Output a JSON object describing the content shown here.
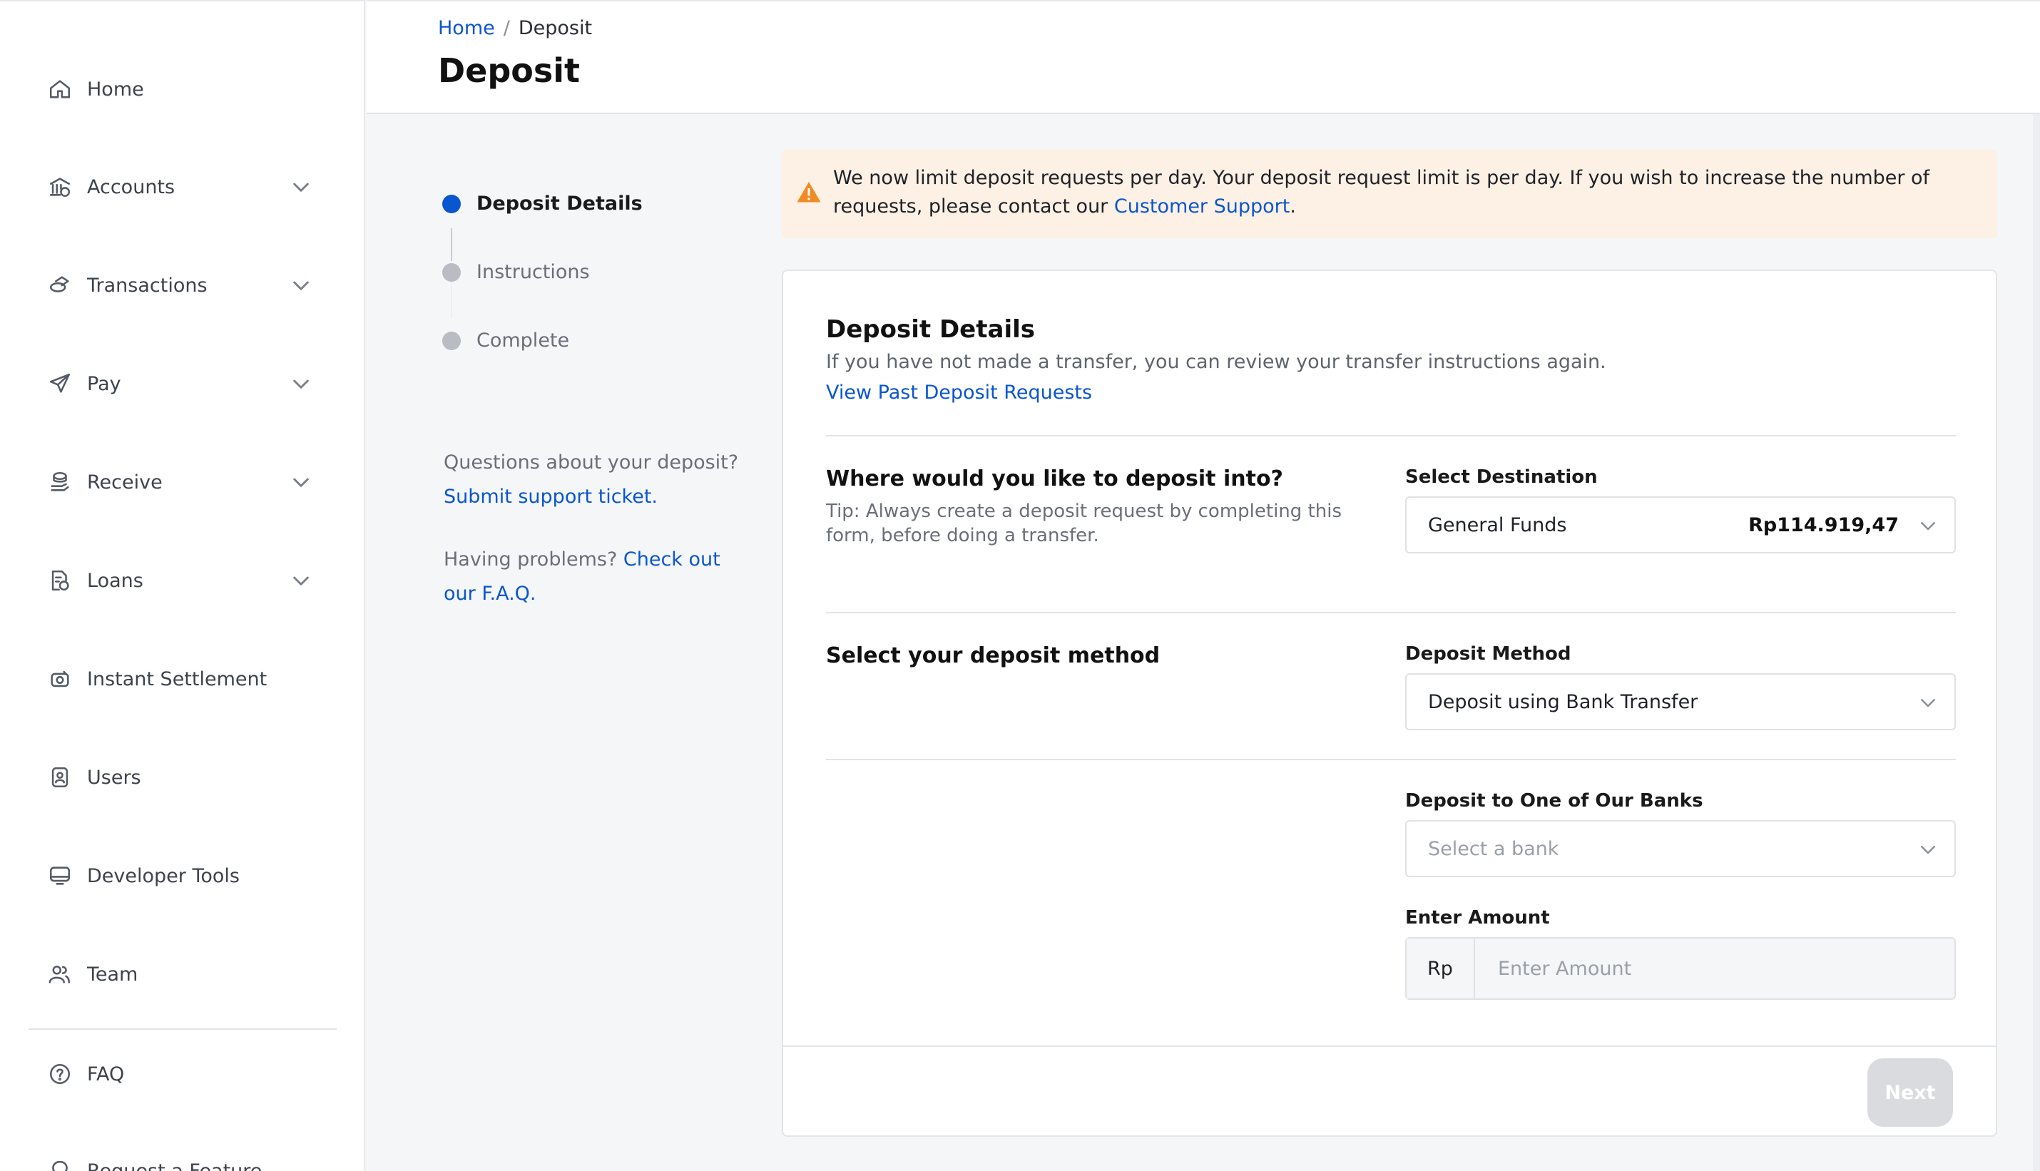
{
  "sidebar": {
    "items": [
      {
        "label": "Home",
        "icon": "home-icon",
        "expandable": false
      },
      {
        "label": "Accounts",
        "icon": "bank-icon",
        "expandable": true
      },
      {
        "label": "Transactions",
        "icon": "transactions-icon",
        "expandable": true
      },
      {
        "label": "Pay",
        "icon": "send-icon",
        "expandable": true
      },
      {
        "label": "Receive",
        "icon": "receive-icon",
        "expandable": true
      },
      {
        "label": "Loans",
        "icon": "loans-icon",
        "expandable": true
      },
      {
        "label": "Instant Settlement",
        "icon": "settlement-icon",
        "expandable": false
      },
      {
        "label": "Users",
        "icon": "users-icon",
        "expandable": false
      },
      {
        "label": "Developer Tools",
        "icon": "monitor-icon",
        "expandable": false
      },
      {
        "label": "Team",
        "icon": "team-icon",
        "expandable": false
      }
    ],
    "bottom_items": [
      {
        "label": "FAQ",
        "icon": "help-circle-icon"
      },
      {
        "label": "Request a Feature",
        "icon": "lightbulb-icon"
      }
    ]
  },
  "header": {
    "breadcrumb": {
      "home": "Home",
      "separator": "/",
      "current": "Deposit"
    },
    "title": "Deposit"
  },
  "stepper": {
    "steps": [
      {
        "label": "Deposit Details",
        "active": true
      },
      {
        "label": "Instructions",
        "active": false
      },
      {
        "label": "Complete",
        "active": false
      }
    ]
  },
  "help": {
    "question": "Questions about your deposit?",
    "support_link": "Submit support ticket.",
    "problems": "Having problems?",
    "faq_link": "Check out our F.A.Q."
  },
  "alert": {
    "text": "We now limit deposit requests per day. Your deposit request limit is per day. If you wish to increase the number of requests, please contact our",
    "link": "Customer Support",
    "suffix": ".",
    "color": "#fdf0e4",
    "icon_color": "#f08a24"
  },
  "card": {
    "title": "Deposit Details",
    "subtitle": "If you have not made a transfer, you can review your transfer instructions again.",
    "past_link": "View Past Deposit Requests",
    "destination_section": {
      "title": "Where would you like to deposit into?",
      "tip": "Tip: Always create a deposit request by completing this form, before doing a transfer.",
      "field_label": "Select Destination",
      "value": "General Funds",
      "amount": "Rp114.919,47"
    },
    "method_section": {
      "title": "Select your deposit method",
      "field_label": "Deposit Method",
      "value": "Deposit using Bank Transfer"
    },
    "bank_field": {
      "label": "Deposit to One of Our Banks",
      "placeholder": "Select a bank"
    },
    "amount_field": {
      "label": "Enter Amount",
      "prefix": "Rp",
      "placeholder": "Enter Amount"
    },
    "next_button": "Next"
  },
  "colors": {
    "accent": "#0a56d0",
    "disabled_button": "#d9dbdf"
  }
}
